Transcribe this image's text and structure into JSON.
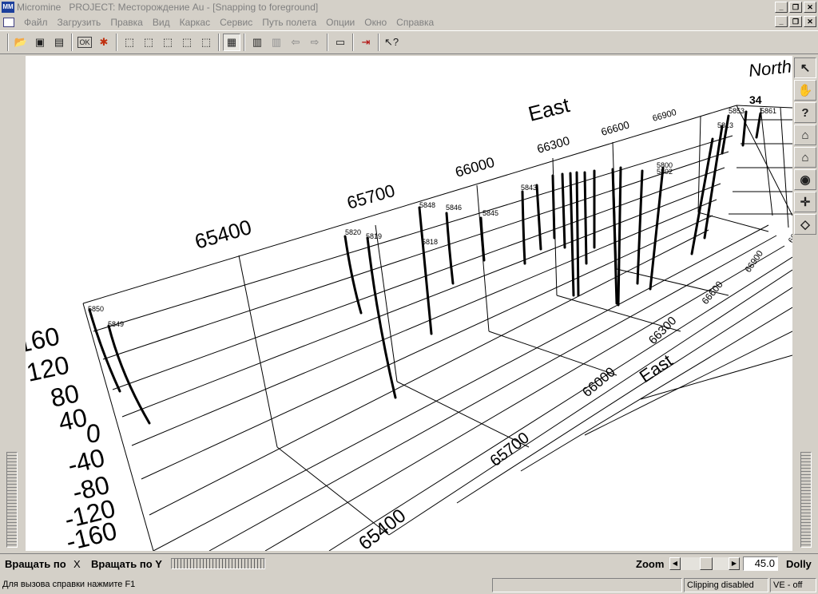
{
  "window": {
    "app_name": "Micromine",
    "project_title": "PROJECT: Месторождение Au - [Snapping to foreground]",
    "app_icon_text": "MM",
    "buttons": [
      "minimize",
      "restore",
      "close"
    ]
  },
  "menu": [
    "Файл",
    "Загрузить",
    "Правка",
    "Вид",
    "Каркас",
    "Сервис",
    "Путь полета",
    "Опции",
    "Окно",
    "Справка"
  ],
  "toolbar": {
    "ok_label": "OK",
    "icons": [
      "open-icon",
      "save-icon",
      "save-all-icon",
      "ok-icon",
      "color-icon",
      "cube-view-1-icon",
      "cube-view-2-icon",
      "cube-view-3-icon",
      "cube-view-4-icon",
      "cube-view-5-icon",
      "grid-icon",
      "stack-icon",
      "stack-faded-icon",
      "arrow-left-icon",
      "arrow-right-icon",
      "window-icon",
      "exit-icon",
      "help-pointer-icon"
    ]
  },
  "viewport": {
    "axis_east_label": "East",
    "axis_north_label": "North",
    "top_easting_ticks": [
      "65400",
      "65700",
      "66000",
      "66300",
      "66600",
      "66900"
    ],
    "bottom_easting_ticks": [
      "65400",
      "65700",
      "66000",
      "66300",
      "66600",
      "66900"
    ],
    "elevation_ticks": [
      "160",
      "120",
      "80",
      "40",
      "0",
      "-40",
      "-80",
      "-120",
      "-160"
    ],
    "north_clipped_tick": "34",
    "drillholes": [
      "5850",
      "5849",
      "5820",
      "5819",
      "5848",
      "5818",
      "5846",
      "5845",
      "5843",
      "5853",
      "5813",
      "5861",
      "5800",
      "5802"
    ]
  },
  "side_tools": [
    "pointer-icon",
    "hand-icon",
    "help-icon",
    "home-icon",
    "home-set-icon",
    "eye-icon",
    "target-icon",
    "cube-icon"
  ],
  "controls": {
    "rotate_x_label": "Вращать по",
    "rotate_x_axis": "X",
    "rotate_y_label": "Вращать по Y",
    "zoom_label": "Zoom",
    "zoom_value": "45.0",
    "dolly_label": "Dolly"
  },
  "status": {
    "help_text": "Для вызова справки нажмите F1",
    "clipping": "Clipping disabled",
    "ve": "VE - off"
  }
}
